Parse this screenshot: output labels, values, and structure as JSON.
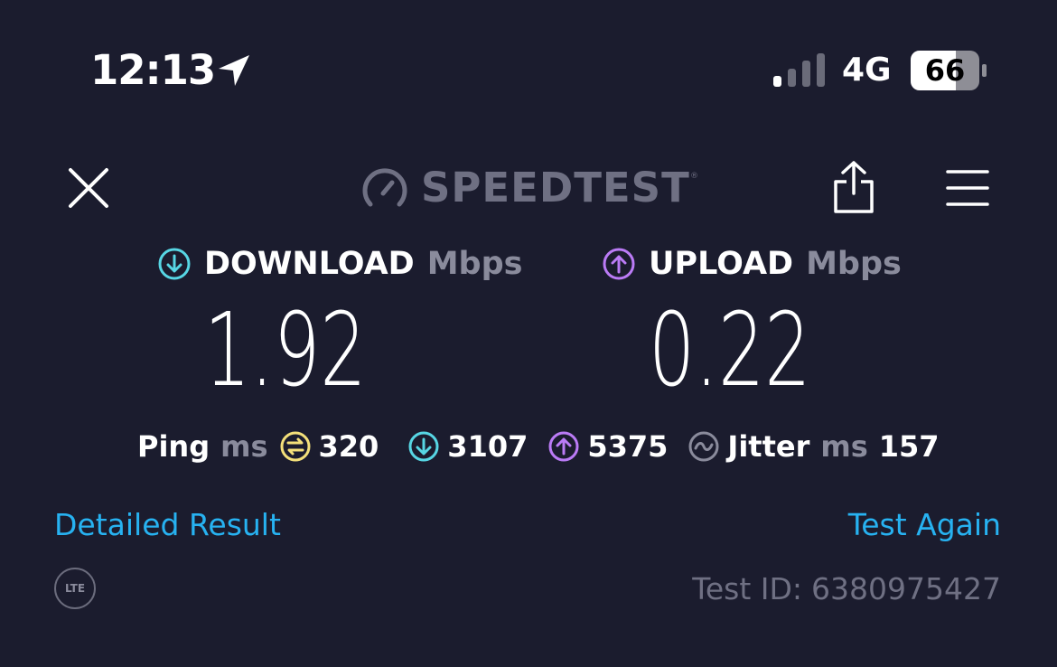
{
  "status_bar": {
    "time": "12:13",
    "network": "4G",
    "battery": "66",
    "location_icon": "location-arrow-icon",
    "signal_icon": "cellular-signal-icon",
    "battery_icon": "battery-icon"
  },
  "toolbar": {
    "close_icon": "close-icon",
    "brand": "SPEEDTEST",
    "brand_mark": "®",
    "brand_icon": "speedometer-icon",
    "share_icon": "share-icon",
    "menu_icon": "hamburger-menu-icon"
  },
  "results": {
    "download": {
      "label": "DOWNLOAD",
      "unit": "Mbps",
      "value": "1.92",
      "color": "#57d6e4"
    },
    "upload": {
      "label": "UPLOAD",
      "unit": "Mbps",
      "value": "0.22",
      "color": "#bb7bf6"
    }
  },
  "stats": {
    "ping_label": "Ping",
    "ping_unit": "ms",
    "idle_ping": "320",
    "download_ping": "3107",
    "upload_ping": "5375",
    "jitter_label": "Jitter",
    "jitter_unit": "ms",
    "jitter": "157",
    "idle_color": "#f4e07a"
  },
  "actions": {
    "detailed_result": "Detailed Result",
    "test_again": "Test Again",
    "link_color": "#27b2f1"
  },
  "footer": {
    "connection_badge": "LTE",
    "test_id_label": "Test ID:",
    "test_id": "6380975427"
  }
}
